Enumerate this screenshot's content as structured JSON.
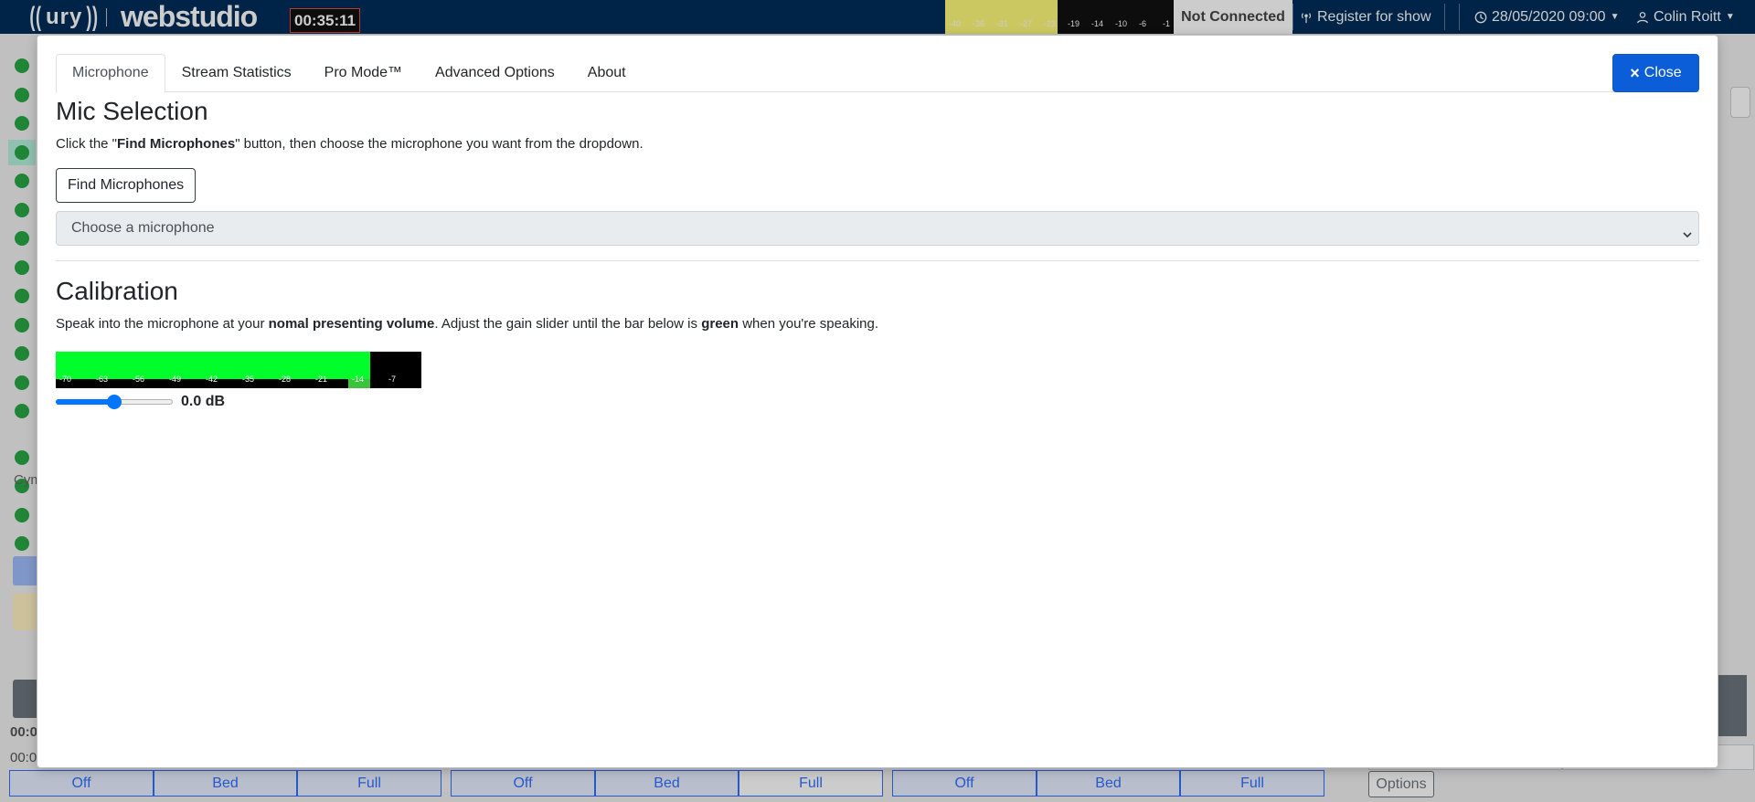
{
  "navbar": {
    "logo_ury": "ury",
    "logo_webstudio": "webstudio",
    "clock": "00:35:11",
    "meter": {
      "level_fraction": 0.49,
      "ticks": [
        "-40",
        "-36",
        "-31",
        "-27",
        "-23",
        "-19",
        "-14",
        "-10",
        "-6",
        "-1"
      ]
    },
    "status": "Not Connected",
    "register_label": "Register for show",
    "date_label": "28/05/2020 09:00",
    "user_label": "Colin Roitt",
    "colors": {
      "bar": "#002d5a",
      "meter_level": "#fffa7a"
    }
  },
  "background": {
    "cym_label": "Cym",
    "time_labels": [
      "00:0",
      "00:0"
    ],
    "options_label": "Options",
    "channel_faders": [
      [
        "Off",
        "Bed",
        "Full"
      ],
      [
        "Off",
        "Bed",
        "Full"
      ],
      [
        "Off",
        "Bed",
        "Full"
      ]
    ]
  },
  "modal": {
    "tabs": [
      {
        "label": "Microphone",
        "active": true
      },
      {
        "label": "Stream Statistics",
        "active": false
      },
      {
        "label": "Pro Mode™",
        "active": false
      },
      {
        "label": "Advanced Options",
        "active": false
      },
      {
        "label": "About",
        "active": false
      }
    ],
    "close_label": "Close",
    "mic_selection": {
      "heading": "Mic Selection",
      "instruction_pre": "Click the \"",
      "instruction_bold": "Find Microphones",
      "instruction_post": "\" button, then choose the microphone you want from the dropdown.",
      "find_button": "Find Microphones",
      "select_value": "Choose a microphone"
    },
    "calibration": {
      "heading": "Calibration",
      "text_1": "Speak into the microphone at your ",
      "bold_1": "nomal presenting volume",
      "text_2": ". Adjust the gain slider until the bar below is ",
      "bold_2": "green",
      "text_3": " when you're speaking.",
      "meter_ticks": [
        "-70",
        "-63",
        "-56",
        "-49",
        "-42",
        "-35",
        "-28",
        "-21",
        "-14",
        "-7"
      ],
      "meter_level_fraction": 0.86,
      "peak_fraction_start": 0.8,
      "colors": {
        "level": "#00ff2a",
        "peak": "#3cc33c",
        "background": "#000000"
      },
      "gain_slider_fraction": 0.5,
      "gain_value": "0.0 dB"
    }
  }
}
